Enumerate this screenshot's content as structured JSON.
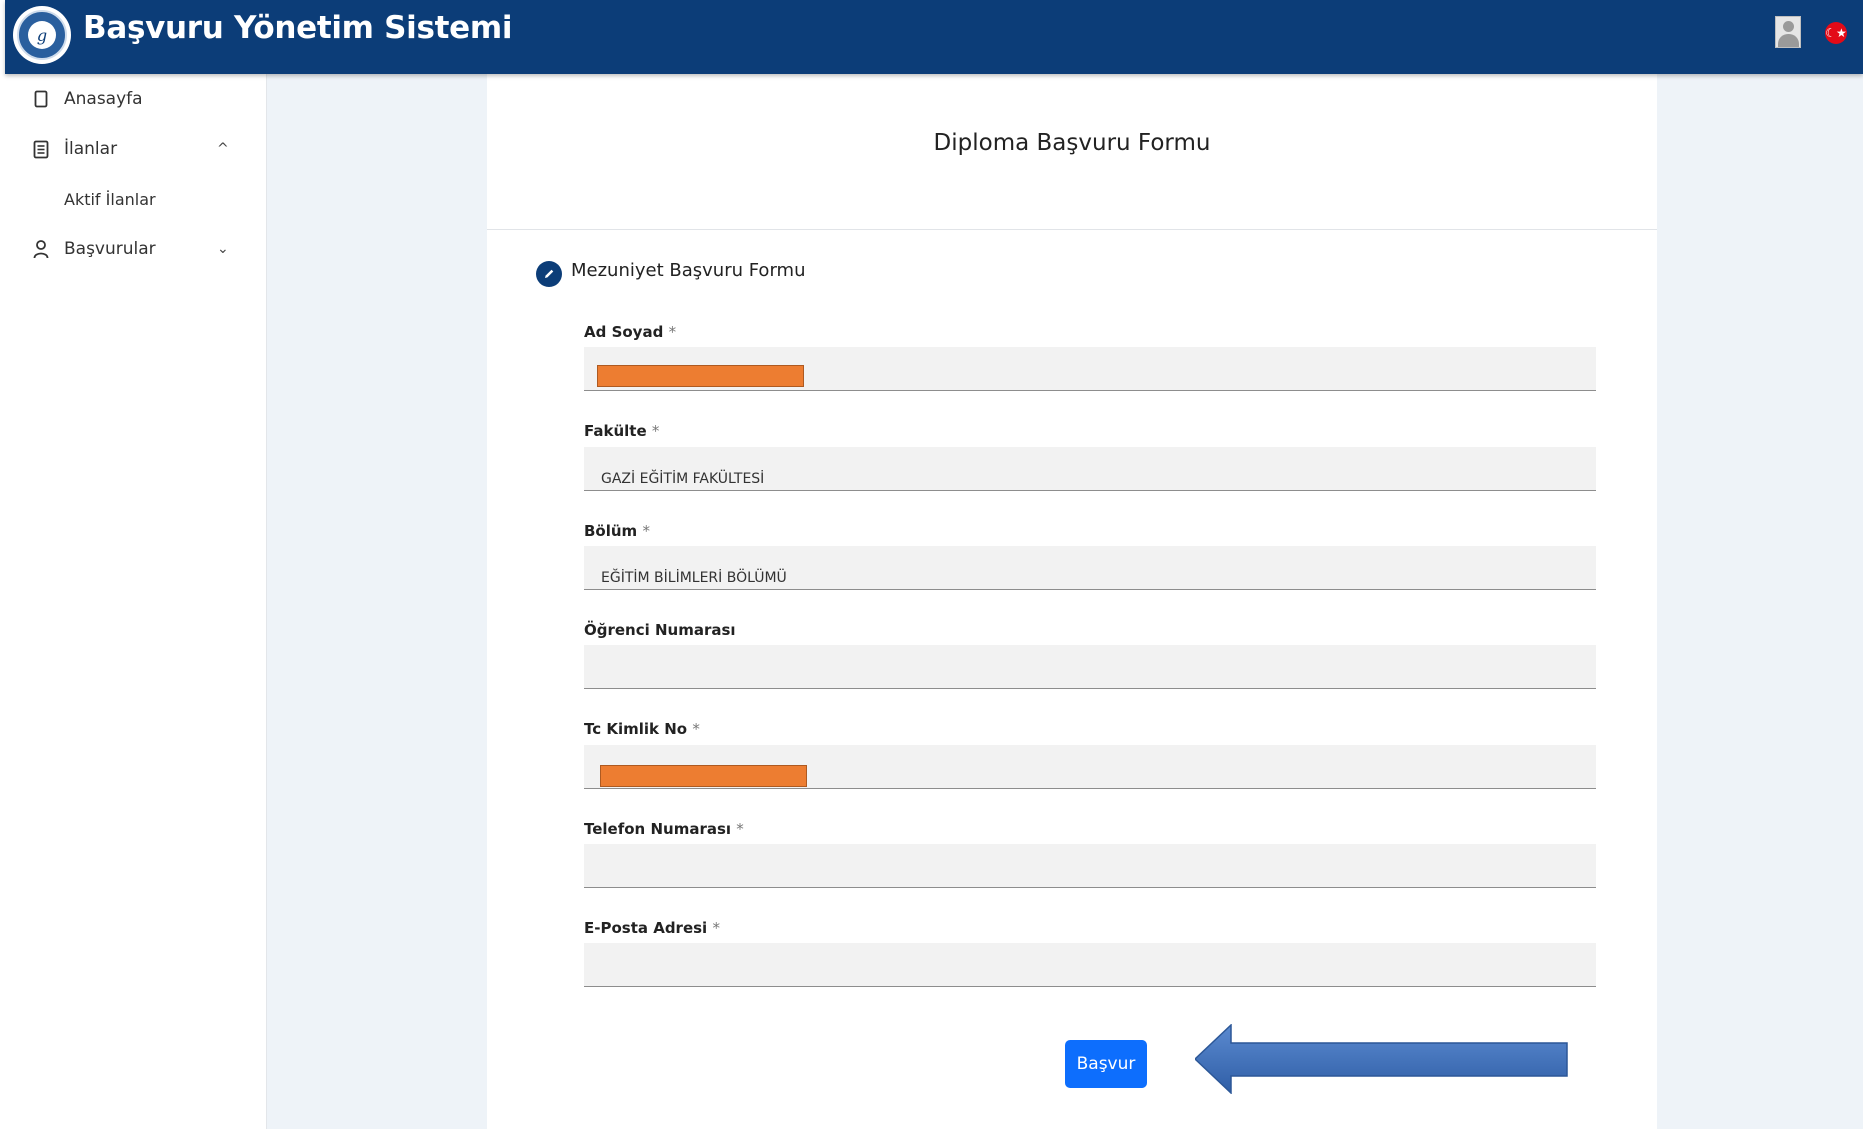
{
  "header": {
    "logo_letter": "g",
    "title": "Başvuru Yönetim Sistemi",
    "flag_symbol": "☾★"
  },
  "sidebar": {
    "items": [
      {
        "label": "Anasayfa",
        "icon": "bookmark-icon"
      },
      {
        "label": "İlanlar",
        "icon": "document-icon",
        "expanded": true
      },
      {
        "label": "Aktif İlanlar",
        "sub": true
      },
      {
        "label": "Başvurular",
        "icon": "user-icon",
        "expanded": false
      }
    ],
    "chevron_up": "^",
    "chevron_down": "⌄"
  },
  "form": {
    "title": "Diploma Başvuru Formu",
    "section_title": "Mezuniyet Başvuru Formu",
    "required_mark": "*",
    "fields": [
      {
        "label": "Ad Soyad",
        "required": true,
        "value": "",
        "redacted": true
      },
      {
        "label": "Fakülte",
        "required": true,
        "value": "GAZİ EĞİTİM FAKÜLTESİ"
      },
      {
        "label": "Bölüm",
        "required": true,
        "value": "EĞİTİM BİLİMLERİ BÖLÜMÜ"
      },
      {
        "label": "Öğrenci Numarası",
        "required": false,
        "value": ""
      },
      {
        "label": "Tc Kimlik No",
        "required": true,
        "value": "",
        "redacted": true
      },
      {
        "label": "Telefon Numarası",
        "required": true,
        "value": ""
      },
      {
        "label": "E-Posta Adresi",
        "required": true,
        "value": ""
      }
    ],
    "submit_label": "Başvur"
  },
  "colors": {
    "header_bg": "#0c3d78",
    "primary_button": "#0d6efd",
    "redaction": "#ed7d31",
    "arrow": "#3f6fb8"
  }
}
